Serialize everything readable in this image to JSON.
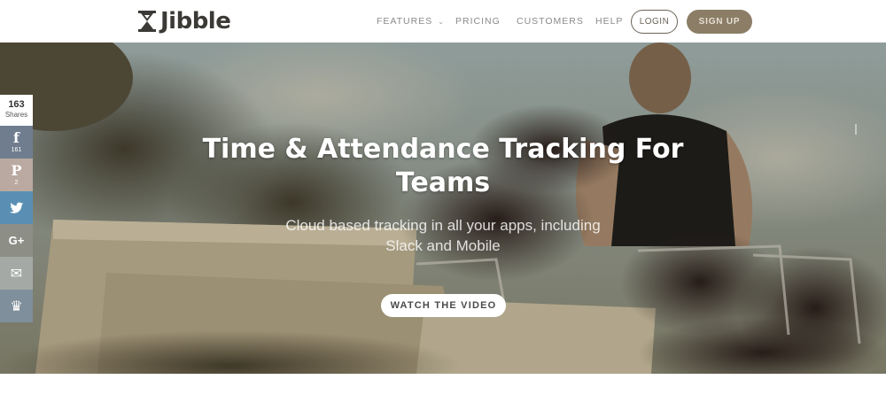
{
  "header": {
    "logo_text": "Jibble",
    "nav": [
      {
        "label": "FEATURES",
        "has_dropdown": true
      },
      {
        "label": "PRICING"
      },
      {
        "label": "CUSTOMERS"
      },
      {
        "label": "HELP"
      }
    ],
    "login_label": "LOGIN",
    "signup_label": "SIGN UP"
  },
  "hero": {
    "title": "Time & Attendance Tracking For Teams",
    "subtitle": "Cloud based tracking in all your apps, including Slack and Mobile",
    "video_button": "WATCH THE VIDEO"
  },
  "share_bar": {
    "total": "163",
    "total_label": "Shares",
    "buttons": [
      {
        "icon": "facebook-icon",
        "glyph": "f",
        "count": "161"
      },
      {
        "icon": "pinterest-icon",
        "glyph": "P",
        "count": "2"
      },
      {
        "icon": "twitter-icon",
        "glyph": "🐦",
        "count": ""
      },
      {
        "icon": "google-plus-icon",
        "glyph": "G+",
        "count": ""
      },
      {
        "icon": "email-icon",
        "glyph": "✉",
        "count": ""
      },
      {
        "icon": "crown-icon",
        "glyph": "♛",
        "count": ""
      }
    ]
  },
  "colors": {
    "brand_dark": "#3b3a36",
    "signup_bg": "#8b7d66",
    "nav_text": "#8a8a8a"
  }
}
